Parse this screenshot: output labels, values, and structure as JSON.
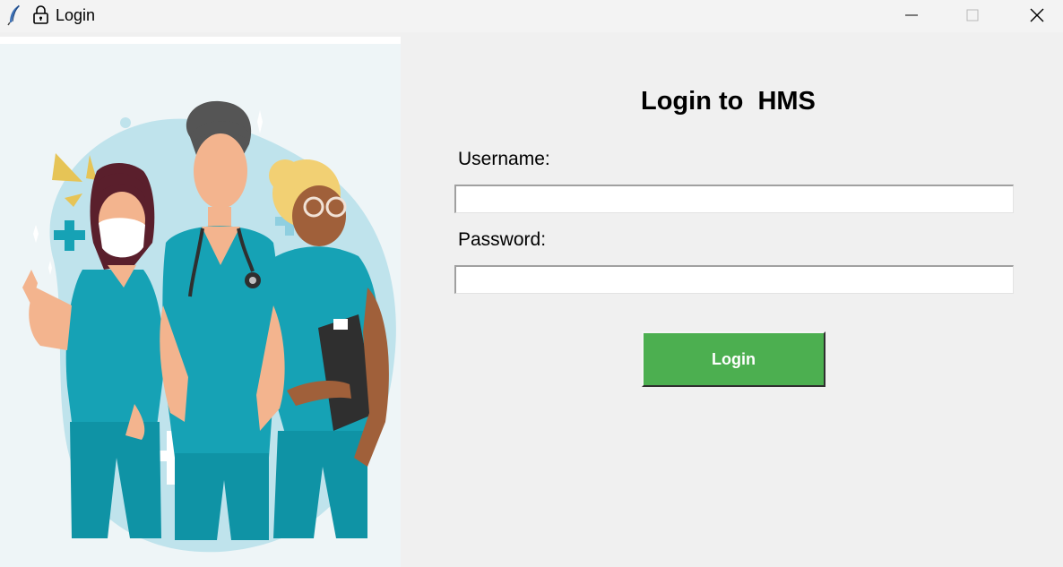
{
  "window": {
    "title": "Login",
    "app_icon": "feather-icon",
    "title_icon": "lock-icon",
    "controls": [
      "minimize-icon",
      "maximize-icon",
      "close-icon"
    ]
  },
  "illustration": {
    "description_icon": "medical-staff-illustration"
  },
  "form": {
    "heading": "Login to  HMS",
    "username_label": "Username:",
    "username_value": "",
    "password_label": "Password:",
    "password_value": "",
    "login_button": "Login"
  },
  "colors": {
    "background": "#f0f0f0",
    "button": "#4caf50",
    "scrubs": "#1aa7b8"
  }
}
